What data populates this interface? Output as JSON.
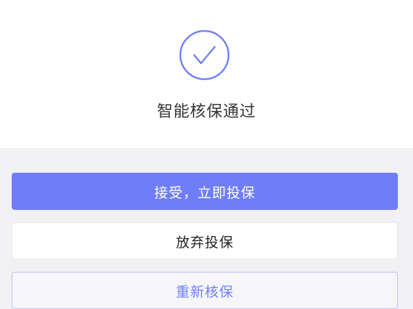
{
  "result": {
    "title": "智能核保通过"
  },
  "actions": {
    "accept_label": "接受，立即投保",
    "abandon_label": "放弃投保",
    "reunderwrite_label": "重新核保"
  },
  "colors": {
    "accent": "#6f7ef8",
    "page_bg": "#ffffff",
    "panel_bg": "#f1f1f4"
  },
  "icons": {
    "status": "check-circle-icon"
  }
}
